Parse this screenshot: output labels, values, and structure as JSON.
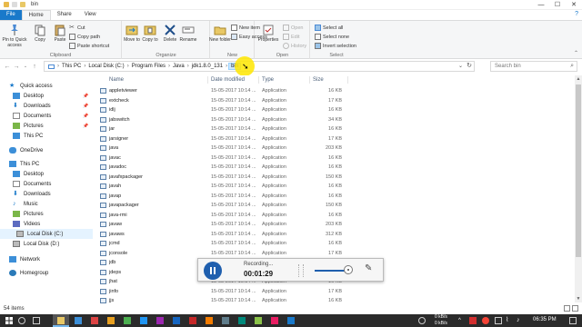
{
  "window": {
    "title": "bin",
    "controls": [
      "—",
      "☐",
      "✕"
    ]
  },
  "ribbon_tabs": {
    "file": "File",
    "home": "Home",
    "share": "Share",
    "view": "View"
  },
  "ribbon": {
    "clipboard": {
      "group_label": "Clipboard",
      "pin": "Pin to Quick access",
      "copy": "Copy",
      "paste": "Paste",
      "cut": "Cut",
      "copy_path": "Copy path",
      "paste_shortcut": "Paste shortcut"
    },
    "organize": {
      "group_label": "Organize",
      "move_to": "Move to",
      "copy_to": "Copy to",
      "delete": "Delete",
      "rename": "Rename"
    },
    "new": {
      "group_label": "New",
      "new_folder": "New folder",
      "new_item": "New item",
      "easy_access": "Easy access"
    },
    "open": {
      "group_label": "Open",
      "properties": "Properties",
      "open": "Open",
      "edit": "Edit",
      "history": "History"
    },
    "select": {
      "group_label": "Select",
      "select_all": "Select all",
      "select_none": "Select none",
      "invert_selection": "Invert selection"
    }
  },
  "address": {
    "crumbs": [
      "This PC",
      "Local Disk (C:)",
      "Program Files",
      "Java",
      "jdk1.8.0_131",
      "bin"
    ],
    "search_placeholder": "Search bin"
  },
  "nav": {
    "quick_access": "Quick access",
    "desktop": "Desktop",
    "downloads": "Downloads",
    "documents": "Documents",
    "pictures": "Pictures",
    "this_pc_quick": "This PC",
    "onedrive": "OneDrive",
    "this_pc": "This PC",
    "desktop2": "Desktop",
    "documents2": "Documents",
    "downloads2": "Downloads",
    "music": "Music",
    "pictures2": "Pictures",
    "videos": "Videos",
    "local_c": "Local Disk (C:)",
    "local_d": "Local Disk (D:)",
    "network": "Network",
    "homegroup": "Homegroup"
  },
  "columns": {
    "name": "Name",
    "date": "Date modified",
    "type": "Type",
    "size": "Size"
  },
  "files": [
    {
      "name": "appletviewer",
      "date": "15-05-2017 10:14 ...",
      "type": "Application",
      "size": "16 KB"
    },
    {
      "name": "extcheck",
      "date": "15-05-2017 10:14 ...",
      "type": "Application",
      "size": "17 KB"
    },
    {
      "name": "idlj",
      "date": "15-05-2017 10:14 ...",
      "type": "Application",
      "size": "16 KB"
    },
    {
      "name": "jabswitch",
      "date": "15-05-2017 10:14 ...",
      "type": "Application",
      "size": "34 KB"
    },
    {
      "name": "jar",
      "date": "15-05-2017 10:14 ...",
      "type": "Application",
      "size": "16 KB"
    },
    {
      "name": "jarsigner",
      "date": "15-05-2017 10:14 ...",
      "type": "Application",
      "size": "17 KB"
    },
    {
      "name": "java",
      "date": "15-05-2017 10:14 ...",
      "type": "Application",
      "size": "203 KB"
    },
    {
      "name": "javac",
      "date": "15-05-2017 10:14 ...",
      "type": "Application",
      "size": "16 KB"
    },
    {
      "name": "javadoc",
      "date": "15-05-2017 10:14 ...",
      "type": "Application",
      "size": "16 KB"
    },
    {
      "name": "javafxpackager",
      "date": "15-05-2017 10:14 ...",
      "type": "Application",
      "size": "150 KB"
    },
    {
      "name": "javah",
      "date": "15-05-2017 10:14 ...",
      "type": "Application",
      "size": "16 KB"
    },
    {
      "name": "javap",
      "date": "15-05-2017 10:14 ...",
      "type": "Application",
      "size": "16 KB"
    },
    {
      "name": "javapackager",
      "date": "15-05-2017 10:14 ...",
      "type": "Application",
      "size": "150 KB"
    },
    {
      "name": "java-rmi",
      "date": "15-05-2017 10:14 ...",
      "type": "Application",
      "size": "16 KB"
    },
    {
      "name": "javaw",
      "date": "15-05-2017 10:14 ...",
      "type": "Application",
      "size": "203 KB"
    },
    {
      "name": "javaws",
      "date": "15-05-2017 10:14 ...",
      "type": "Application",
      "size": "312 KB"
    },
    {
      "name": "jcmd",
      "date": "15-05-2017 10:14 ...",
      "type": "Application",
      "size": "16 KB"
    },
    {
      "name": "jconsole",
      "date": "15-05-2017 10:14 ...",
      "type": "Application",
      "size": "17 KB"
    },
    {
      "name": "jdb",
      "date": "15-05-2017 10:14 ...",
      "type": "Application",
      "size": "17 KB"
    },
    {
      "name": "jdeps",
      "date": "15-05-2017 10:14 ...",
      "type": "Application",
      "size": "16 KB"
    },
    {
      "name": "jhat",
      "date": "15-05-2017 10:14 ...",
      "type": "Application",
      "size": "16 KB"
    },
    {
      "name": "jinfo",
      "date": "15-05-2017 10:14 ...",
      "type": "Application",
      "size": "17 KB"
    },
    {
      "name": "jjs",
      "date": "15-05-2017 10:14 ...",
      "type": "Application",
      "size": "16 KB"
    },
    {
      "name": "jli.dll",
      "date": "15-05-2017 10:14 ...",
      "type": "Application extens...",
      "size": "203 KB"
    }
  ],
  "status": {
    "items": "54 items"
  },
  "recorder": {
    "status": "Recording...",
    "elapsed": "00:01:29"
  },
  "taskbar": {
    "time": "06:35 PM",
    "net_up": "0 kB/s",
    "net_down": "0 kB/s"
  },
  "colors": {
    "accent": "#1979ca",
    "selection": "#cce8ff",
    "taskbar": "#2b2b2b",
    "recorder_button": "#1f5fae",
    "cursor_highlight": "#ffe600"
  }
}
